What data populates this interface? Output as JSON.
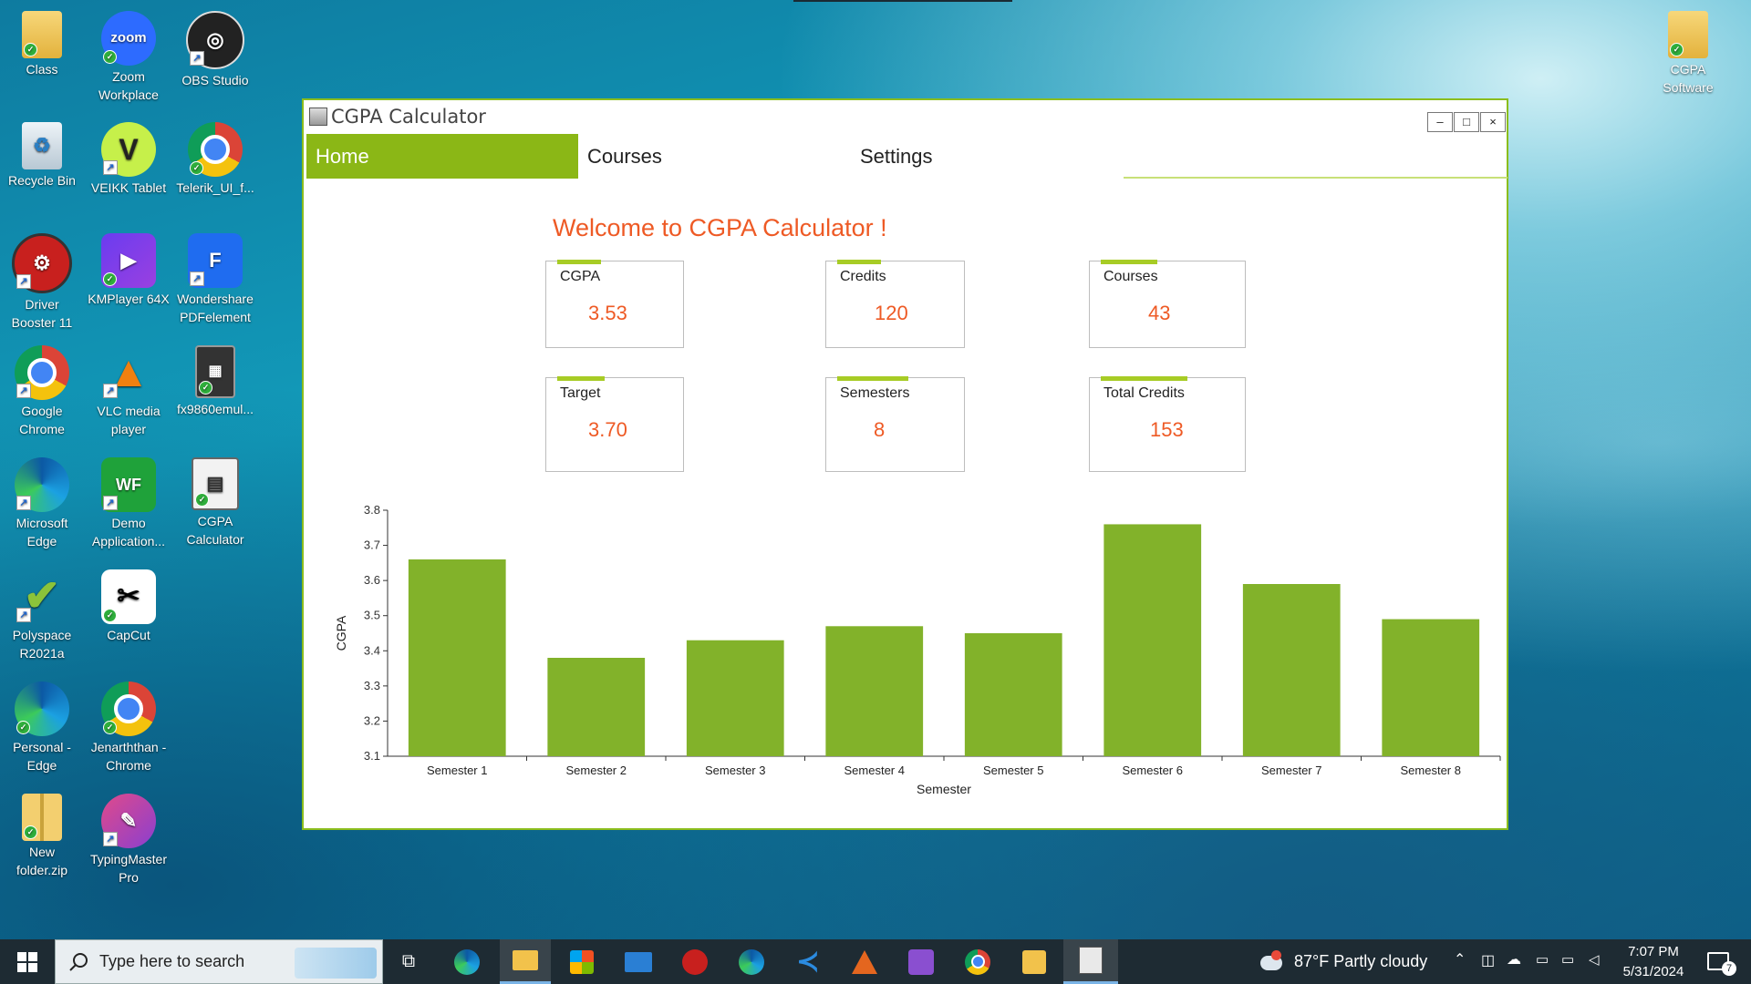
{
  "desktop": {
    "icons": [
      {
        "label": "Class",
        "icon": "folder-icon"
      },
      {
        "label": "Zoom\nWorkplace",
        "icon": "zoom-icon"
      },
      {
        "label": "OBS Studio",
        "icon": "obs-icon"
      },
      {
        "label": "Recycle Bin",
        "icon": "recycle-bin-icon"
      },
      {
        "label": "VEIKK Tablet",
        "icon": "veikk-icon"
      },
      {
        "label": "Telerik_UI_f...",
        "icon": "chrome-icon"
      },
      {
        "label": "Driver\nBooster 11",
        "icon": "driver-booster-icon"
      },
      {
        "label": "KMPlayer 64X",
        "icon": "kmplayer-icon"
      },
      {
        "label": "Wondershare\nPDFelement",
        "icon": "pdfelement-icon"
      },
      {
        "label": "Google\nChrome",
        "icon": "chrome-icon"
      },
      {
        "label": "VLC media\nplayer",
        "icon": "vlc-icon"
      },
      {
        "label": "fx9860emul...",
        "icon": "calculator-icon"
      },
      {
        "label": "Microsoft\nEdge",
        "icon": "edge-icon"
      },
      {
        "label": "Demo\nApplication...",
        "icon": "wf-icon"
      },
      {
        "label": "CGPA\nCalculator",
        "icon": "cgpa-calculator-icon"
      },
      {
        "label": "Polyspace\nR2021a",
        "icon": "polyspace-icon"
      },
      {
        "label": "CapCut",
        "icon": "capcut-icon"
      },
      {
        "label": "Personal -\nEdge",
        "icon": "edge-icon"
      },
      {
        "label": "Jenarththan -\nChrome",
        "icon": "chrome-icon"
      },
      {
        "label": "New\nfolder.zip",
        "icon": "zip-folder-icon"
      },
      {
        "label": "TypingMaster\nPro",
        "icon": "typingmaster-icon"
      },
      {
        "label": "CGPA\nSoftware",
        "icon": "folder-icon"
      }
    ]
  },
  "window": {
    "title": "CGPA Calculator",
    "minimize": "–",
    "maximize": "□",
    "close": "×",
    "tabs": [
      {
        "label": "Home",
        "active": true
      },
      {
        "label": "Courses",
        "active": false
      },
      {
        "label": "Settings",
        "active": false
      }
    ],
    "welcome": "Welcome to CGPA Calculator !",
    "stats": [
      {
        "label": "CGPA",
        "value": "3.53"
      },
      {
        "label": "Credits",
        "value": "120"
      },
      {
        "label": "Courses",
        "value": "43"
      },
      {
        "label": "Target",
        "value": "3.70"
      },
      {
        "label": "Semesters",
        "value": "8"
      },
      {
        "label": "Total Credits",
        "value": "153"
      }
    ],
    "colors": {
      "accent": "#8bb716",
      "value": "#ee5a25",
      "bar": "#82b22a"
    }
  },
  "chart_data": {
    "type": "bar",
    "categories": [
      "Semester 1",
      "Semester 2",
      "Semester 3",
      "Semester 4",
      "Semester 5",
      "Semester 6",
      "Semester 7",
      "Semester 8"
    ],
    "values": [
      3.66,
      3.38,
      3.43,
      3.47,
      3.45,
      3.76,
      3.59,
      3.49
    ],
    "xlabel": "Semester",
    "ylabel": "CGPA",
    "ylim": [
      3.1,
      3.8
    ],
    "yticks": [
      "3.1",
      "3.2",
      "3.3",
      "3.4",
      "3.5",
      "3.6",
      "3.7",
      "3.8"
    ],
    "grid": false
  },
  "taskbar": {
    "search_placeholder": "Type here to search",
    "weather": "87°F  Partly cloudy",
    "time": "7:07 PM",
    "date": "5/31/2024",
    "notification_count": "7",
    "apps": [
      "task-view-icon",
      "edge-icon",
      "file-explorer-icon",
      "store-icon",
      "mail-icon",
      "driver-booster-icon",
      "edge-icon",
      "vscode-icon",
      "matlab-icon",
      "visual-studio-icon",
      "chrome-icon",
      "snip-icon",
      "cgpa-calculator-icon"
    ]
  }
}
